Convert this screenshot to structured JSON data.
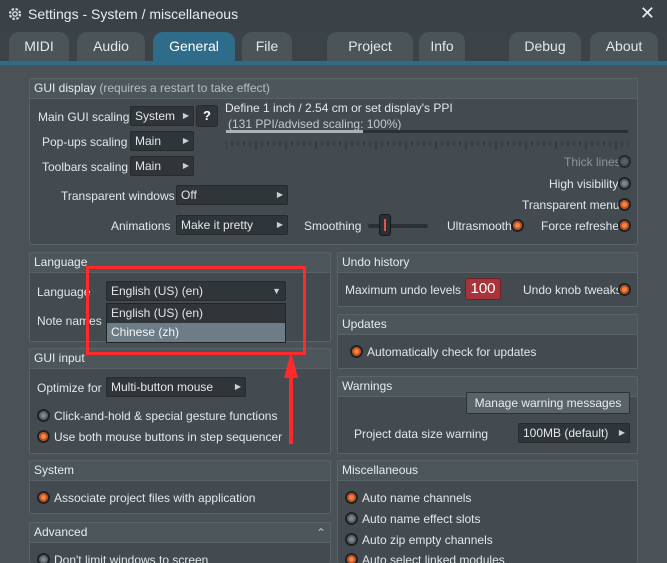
{
  "window": {
    "title": "Settings - System / miscellaneous",
    "close_label": "✕"
  },
  "tabs": [
    {
      "label": "MIDI"
    },
    {
      "label": "Audio"
    },
    {
      "label": "General"
    },
    {
      "label": "File"
    },
    {
      "label": "Project"
    },
    {
      "label": "Info"
    },
    {
      "label": "Debug"
    },
    {
      "label": "About"
    }
  ],
  "gui_display": {
    "header": "GUI display",
    "header_note": " (requires a restart to take effect)",
    "main_scaling_label": "Main GUI scaling",
    "main_scaling_value": "System",
    "help_button": "?",
    "define_text": "Define 1 inch / 2.54 cm or set display's PPI",
    "ppi_text": "(131 PPI/advised scaling: 100%)",
    "ppi_progress": 0.34,
    "popups_label": "Pop-ups scaling",
    "popups_value": "Main",
    "toolbars_label": "Toolbars scaling",
    "toolbars_value": "Main",
    "transparent_windows_label": "Transparent windows",
    "transparent_windows_value": "Off",
    "animations_label": "Animations",
    "animations_value": "Make it pretty",
    "smoothing_label": "Smoothing",
    "ultrasmooth_label": "Ultrasmooth",
    "thick_lines_label": "Thick lines",
    "high_visibility_label": "High visibility",
    "transparent_menus_label": "Transparent menus",
    "force_refreshes_label": "Force refreshes"
  },
  "language": {
    "header": "Language",
    "language_label": "Language",
    "language_value": "English (US) (en)",
    "note_label": "Note names",
    "options": [
      "English (US) (en)",
      "Chinese (zh)"
    ],
    "highlighted_option": "Chinese (zh)"
  },
  "gui_input": {
    "header": "GUI input",
    "optimize_label": "Optimize for",
    "optimize_value": "Multi-button mouse",
    "click_hold_label": "Click-and-hold & special gesture functions",
    "both_buttons_label": "Use both mouse buttons in step sequencer"
  },
  "system": {
    "header": "System",
    "associate_label": "Associate project files with application"
  },
  "advanced": {
    "header": "Advanced",
    "collapse_glyph": "⌃",
    "dont_limit_label": "Don't limit windows to screen"
  },
  "undo_history": {
    "header": "Undo history",
    "max_levels_label": "Maximum undo levels",
    "max_levels_value": "100",
    "knob_tweaks_label": "Undo knob tweaks"
  },
  "updates": {
    "header": "Updates",
    "auto_check_label": "Automatically check for updates"
  },
  "warnings": {
    "header": "Warnings",
    "manage_button": "Manage warning messages",
    "project_size_label": "Project data size warning",
    "project_size_value": "100MB (default)"
  },
  "miscellaneous": {
    "header": "Miscellaneous",
    "items": [
      "Auto name channels",
      "Auto name effect slots",
      "Auto zip empty channels",
      "Auto select linked modules"
    ]
  },
  "colors": {
    "accent_tab": "#2e6c8a",
    "led_on": "#f2864a",
    "annotation_red": "#ff2a2a",
    "undo_box": "#a9333a"
  }
}
